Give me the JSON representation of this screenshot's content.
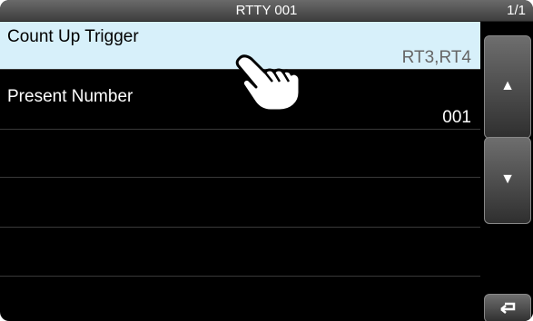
{
  "header": {
    "title": "RTTY 001",
    "page": "1/1"
  },
  "list": {
    "items": [
      {
        "label": "Count Up Trigger",
        "value": "RT3,RT4"
      },
      {
        "label": "Present Number",
        "value": "001"
      },
      {
        "label": "",
        "value": ""
      },
      {
        "label": "",
        "value": ""
      },
      {
        "label": "",
        "value": ""
      }
    ]
  },
  "sidebar": {
    "up_icon": "up-triangle-icon",
    "down_icon": "down-triangle-icon",
    "back_icon": "return-arrow-icon"
  },
  "colors": {
    "selected_bg": "#d7f0fa",
    "screen_bg": "#000000"
  }
}
